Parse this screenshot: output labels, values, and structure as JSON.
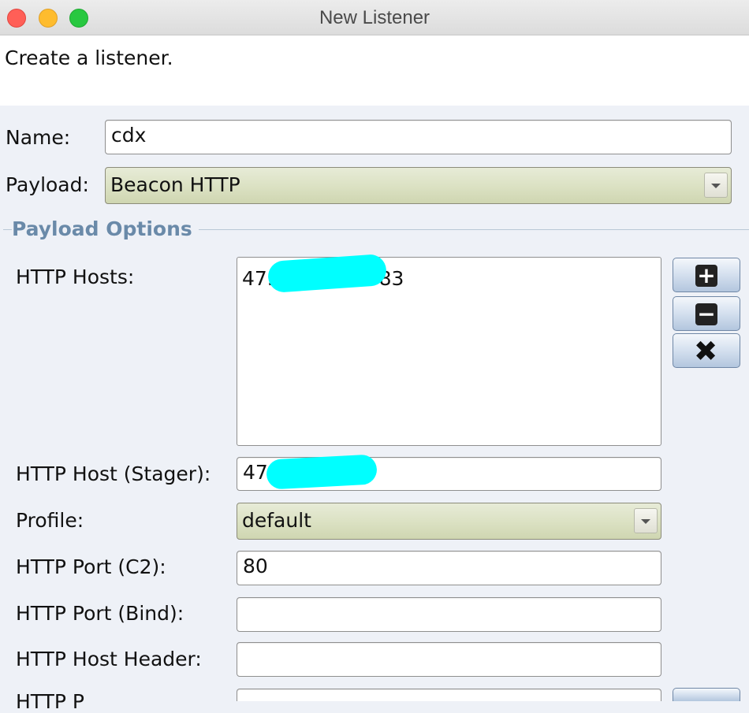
{
  "window": {
    "title": "New Listener"
  },
  "header": {
    "description": "Create a listener."
  },
  "form": {
    "name_label": "Name:",
    "name_value": "cdx",
    "payload_label": "Payload:",
    "payload_value": "Beacon HTTP"
  },
  "payload_options": {
    "section_title": "Payload Options",
    "http_hosts_label": "HTTP Hosts:",
    "http_hosts": [
      "47.•••.•••.••83"
    ],
    "host_buttons": {
      "add_icon": "plus-icon",
      "remove_icon": "minus-icon",
      "clear_icon": "x-icon"
    },
    "stager_label": "HTTP Host (Stager):",
    "stager_value": "47.",
    "profile_label": "Profile:",
    "profile_value": "default",
    "port_c2_label": "HTTP Port (C2):",
    "port_c2_value": "80",
    "port_bind_label": "HTTP Port (Bind):",
    "port_bind_value": "",
    "host_header_label": "HTTP Host Header:",
    "host_header_value": "",
    "partial_label": "HTTP P"
  },
  "colors": {
    "section_title": "#6a8aa9",
    "redaction": "#00ffff",
    "combo_bg": "#dce2c4"
  }
}
